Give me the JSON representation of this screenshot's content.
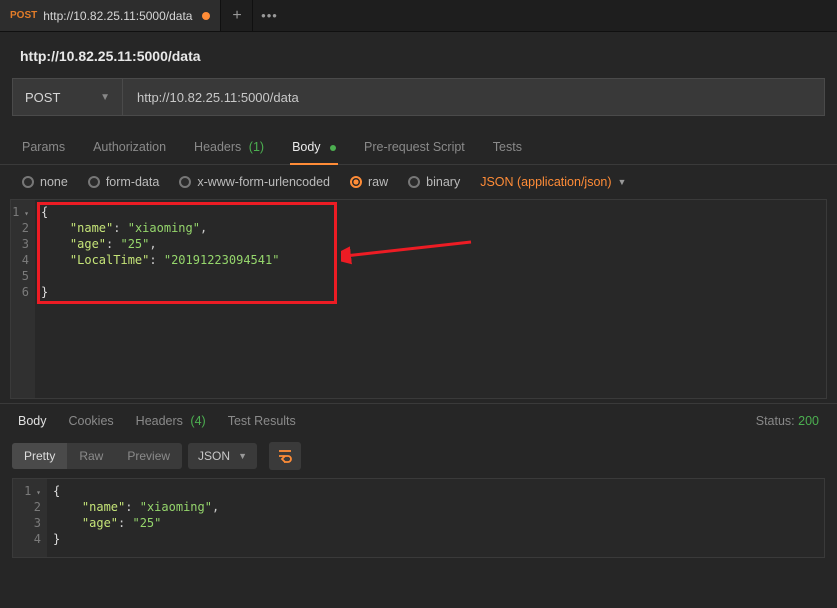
{
  "tab": {
    "method": "POST",
    "url": "http://10.82.25.11:5000/data"
  },
  "page_title": "http://10.82.25.11:5000/data",
  "request": {
    "method": "POST",
    "url": "http://10.82.25.11:5000/data",
    "subtabs": {
      "params": "Params",
      "authorization": "Authorization",
      "headers": "Headers",
      "headers_count": "(1)",
      "body": "Body",
      "prerequest": "Pre-request Script",
      "tests": "Tests"
    },
    "body_types": {
      "none": "none",
      "formdata": "form-data",
      "xwww": "x-www-form-urlencoded",
      "raw": "raw",
      "binary": "binary",
      "content_type": "JSON (application/json)"
    },
    "code": {
      "l1": "{",
      "l2_key": "\"name\"",
      "l2_val": "\"xiaoming\"",
      "l3_key": "\"age\"",
      "l3_val": "\"25\"",
      "l4_key": "\"LocalTime\"",
      "l4_val": "\"20191223094541\"",
      "l5": "",
      "l6": "}"
    }
  },
  "response": {
    "tabs": {
      "body": "Body",
      "cookies": "Cookies",
      "headers": "Headers",
      "headers_count": "(4)",
      "test_results": "Test Results"
    },
    "status_label": "Status:",
    "status_value": "200",
    "view": {
      "pretty": "Pretty",
      "raw": "Raw",
      "preview": "Preview",
      "format": "JSON"
    },
    "code": {
      "l1": "{",
      "l2_key": "\"name\"",
      "l2_val": "\"xiaoming\"",
      "l3_key": "\"age\"",
      "l3_val": "\"25\"",
      "l4": "}"
    }
  }
}
